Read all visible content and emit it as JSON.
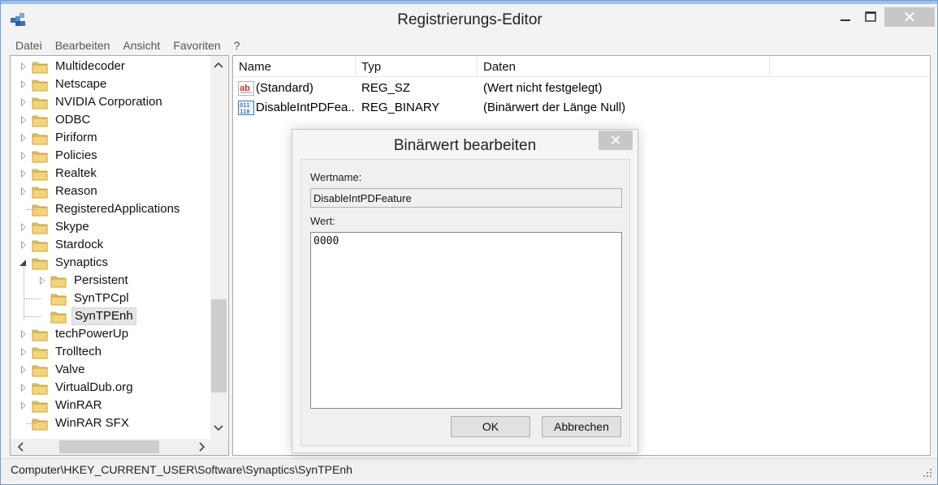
{
  "window": {
    "title": "Registrierungs-Editor",
    "close_glyph": "✕"
  },
  "menu": [
    "Datei",
    "Bearbeiten",
    "Ansicht",
    "Favoriten",
    "?"
  ],
  "tree": {
    "items": [
      {
        "label": "Multidecoder",
        "level": 0,
        "state": "closed"
      },
      {
        "label": "Netscape",
        "level": 0,
        "state": "closed"
      },
      {
        "label": "NVIDIA Corporation",
        "level": 0,
        "state": "closed"
      },
      {
        "label": "ODBC",
        "level": 0,
        "state": "closed"
      },
      {
        "label": "Piriform",
        "level": 0,
        "state": "closed"
      },
      {
        "label": "Policies",
        "level": 0,
        "state": "closed"
      },
      {
        "label": "Realtek",
        "level": 0,
        "state": "closed"
      },
      {
        "label": "Reason",
        "level": 0,
        "state": "closed"
      },
      {
        "label": "RegisteredApplications",
        "level": 0,
        "state": "none"
      },
      {
        "label": "Skype",
        "level": 0,
        "state": "closed"
      },
      {
        "label": "Stardock",
        "level": 0,
        "state": "closed"
      },
      {
        "label": "Synaptics",
        "level": 0,
        "state": "open"
      },
      {
        "label": "Persistent",
        "level": 1,
        "state": "closed"
      },
      {
        "label": "SynTPCpl",
        "level": 1,
        "state": "none"
      },
      {
        "label": "SynTPEnh",
        "level": 1,
        "state": "none",
        "selected": true
      },
      {
        "label": "techPowerUp",
        "level": 0,
        "state": "closed"
      },
      {
        "label": "Trolltech",
        "level": 0,
        "state": "closed"
      },
      {
        "label": "Valve",
        "level": 0,
        "state": "closed"
      },
      {
        "label": "VirtualDub.org",
        "level": 0,
        "state": "closed"
      },
      {
        "label": "WinRAR",
        "level": 0,
        "state": "closed"
      },
      {
        "label": "WinRAR SFX",
        "level": 0,
        "state": "none"
      }
    ]
  },
  "list": {
    "columns": [
      "Name",
      "Typ",
      "Daten"
    ],
    "rows": [
      {
        "name": "(Standard)",
        "type": "REG_SZ",
        "data": "(Wert nicht festgelegt)",
        "icon": "string-value-icon"
      },
      {
        "name": "DisableIntPDFea...",
        "type": "REG_BINARY",
        "data": "(Binärwert der Länge Null)",
        "icon": "binary-value-icon"
      }
    ]
  },
  "dialog": {
    "title": "Binärwert bearbeiten",
    "value_name_label": "Wertname:",
    "value_name": "DisableIntPDFeature",
    "value_label": "Wert:",
    "value_data": "0000",
    "ok_label": "OK",
    "cancel_label": "Abbrechen",
    "close_glyph": "✕"
  },
  "statusbar": {
    "path": "Computer\\HKEY_CURRENT_USER\\Software\\Synaptics\\SynTPEnh"
  },
  "colors": {
    "folder": "#e8c25a",
    "selection": "#e5e5e5",
    "border_accent": "#6d9fd4"
  }
}
